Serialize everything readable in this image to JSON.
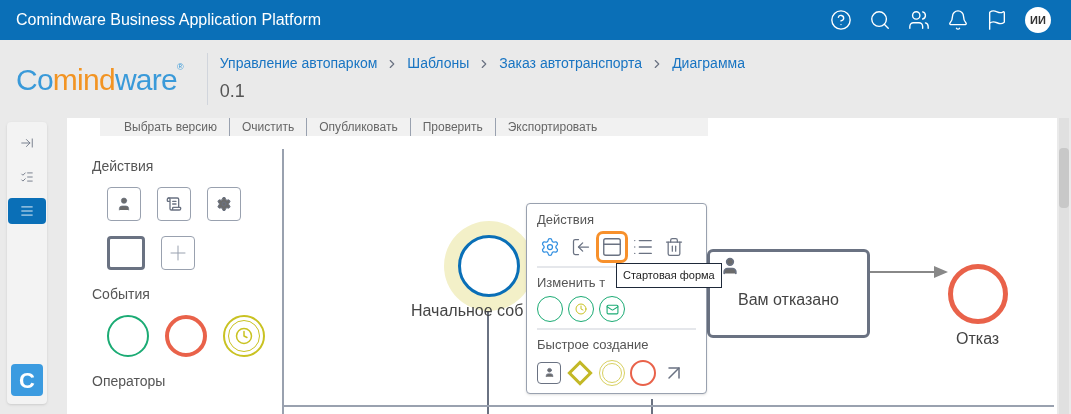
{
  "header": {
    "title": "Comindware Business Application Platform",
    "avatar": "ИИ"
  },
  "logo": {
    "segments": [
      {
        "text": "Co",
        "color": "#3a9ad9"
      },
      {
        "text": "mind",
        "color": "#f29423"
      },
      {
        "text": "ware",
        "color": "#3a9ad9"
      }
    ],
    "mark": "®"
  },
  "breadcrumbs": [
    "Управление автопарком",
    "Шаблоны",
    "Заказ автотранспорта",
    "Диаграмма"
  ],
  "version": "0.1",
  "side_rail": {
    "items": [
      {
        "kind": "collapse",
        "selected": false
      },
      {
        "kind": "checklist",
        "selected": false
      },
      {
        "kind": "menu",
        "selected": true
      }
    ],
    "app_badge": "C"
  },
  "toolbar": [
    "Выбрать версию",
    "Очистить",
    "Опубликовать",
    "Проверить",
    "Экспортировать"
  ],
  "palette": {
    "sections": [
      {
        "title": "Действия",
        "items": [
          {
            "kind": "user-task"
          },
          {
            "kind": "script-task"
          },
          {
            "kind": "service-task"
          },
          {
            "kind": "task"
          },
          {
            "kind": "add"
          }
        ]
      },
      {
        "title": "События",
        "items": [
          {
            "kind": "start-event"
          },
          {
            "kind": "end-event"
          },
          {
            "kind": "timer-event"
          }
        ]
      },
      {
        "title": "Операторы"
      }
    ]
  },
  "diagram": {
    "nodes": [
      {
        "kind": "start",
        "label": "Начальное соб",
        "selected": true
      },
      {
        "kind": "user-task",
        "label": "Вам отказано",
        "selected": false
      },
      {
        "kind": "end",
        "label": "Отказ",
        "selected": false
      }
    ]
  },
  "context_menu": {
    "sections": [
      {
        "title": "Действия",
        "items": [
          {
            "kind": "settings",
            "selected": false
          },
          {
            "kind": "exit",
            "selected": false
          },
          {
            "kind": "form",
            "selected": true
          },
          {
            "kind": "list",
            "selected": false
          },
          {
            "kind": "delete",
            "selected": false
          }
        ]
      },
      {
        "title": "Изменить т",
        "items": [
          {
            "kind": "start-event",
            "selected": false
          },
          {
            "kind": "timer-event",
            "selected": false
          },
          {
            "kind": "message-event",
            "selected": false
          }
        ]
      },
      {
        "title": "Быстрое создание",
        "items": [
          {
            "kind": "user-task",
            "selected": false
          },
          {
            "kind": "gateway",
            "selected": false
          },
          {
            "kind": "intermediate-event",
            "selected": false
          },
          {
            "kind": "end-event",
            "selected": false
          },
          {
            "kind": "connector",
            "selected": false
          }
        ]
      }
    ]
  },
  "tooltip": "Стартовая форма"
}
